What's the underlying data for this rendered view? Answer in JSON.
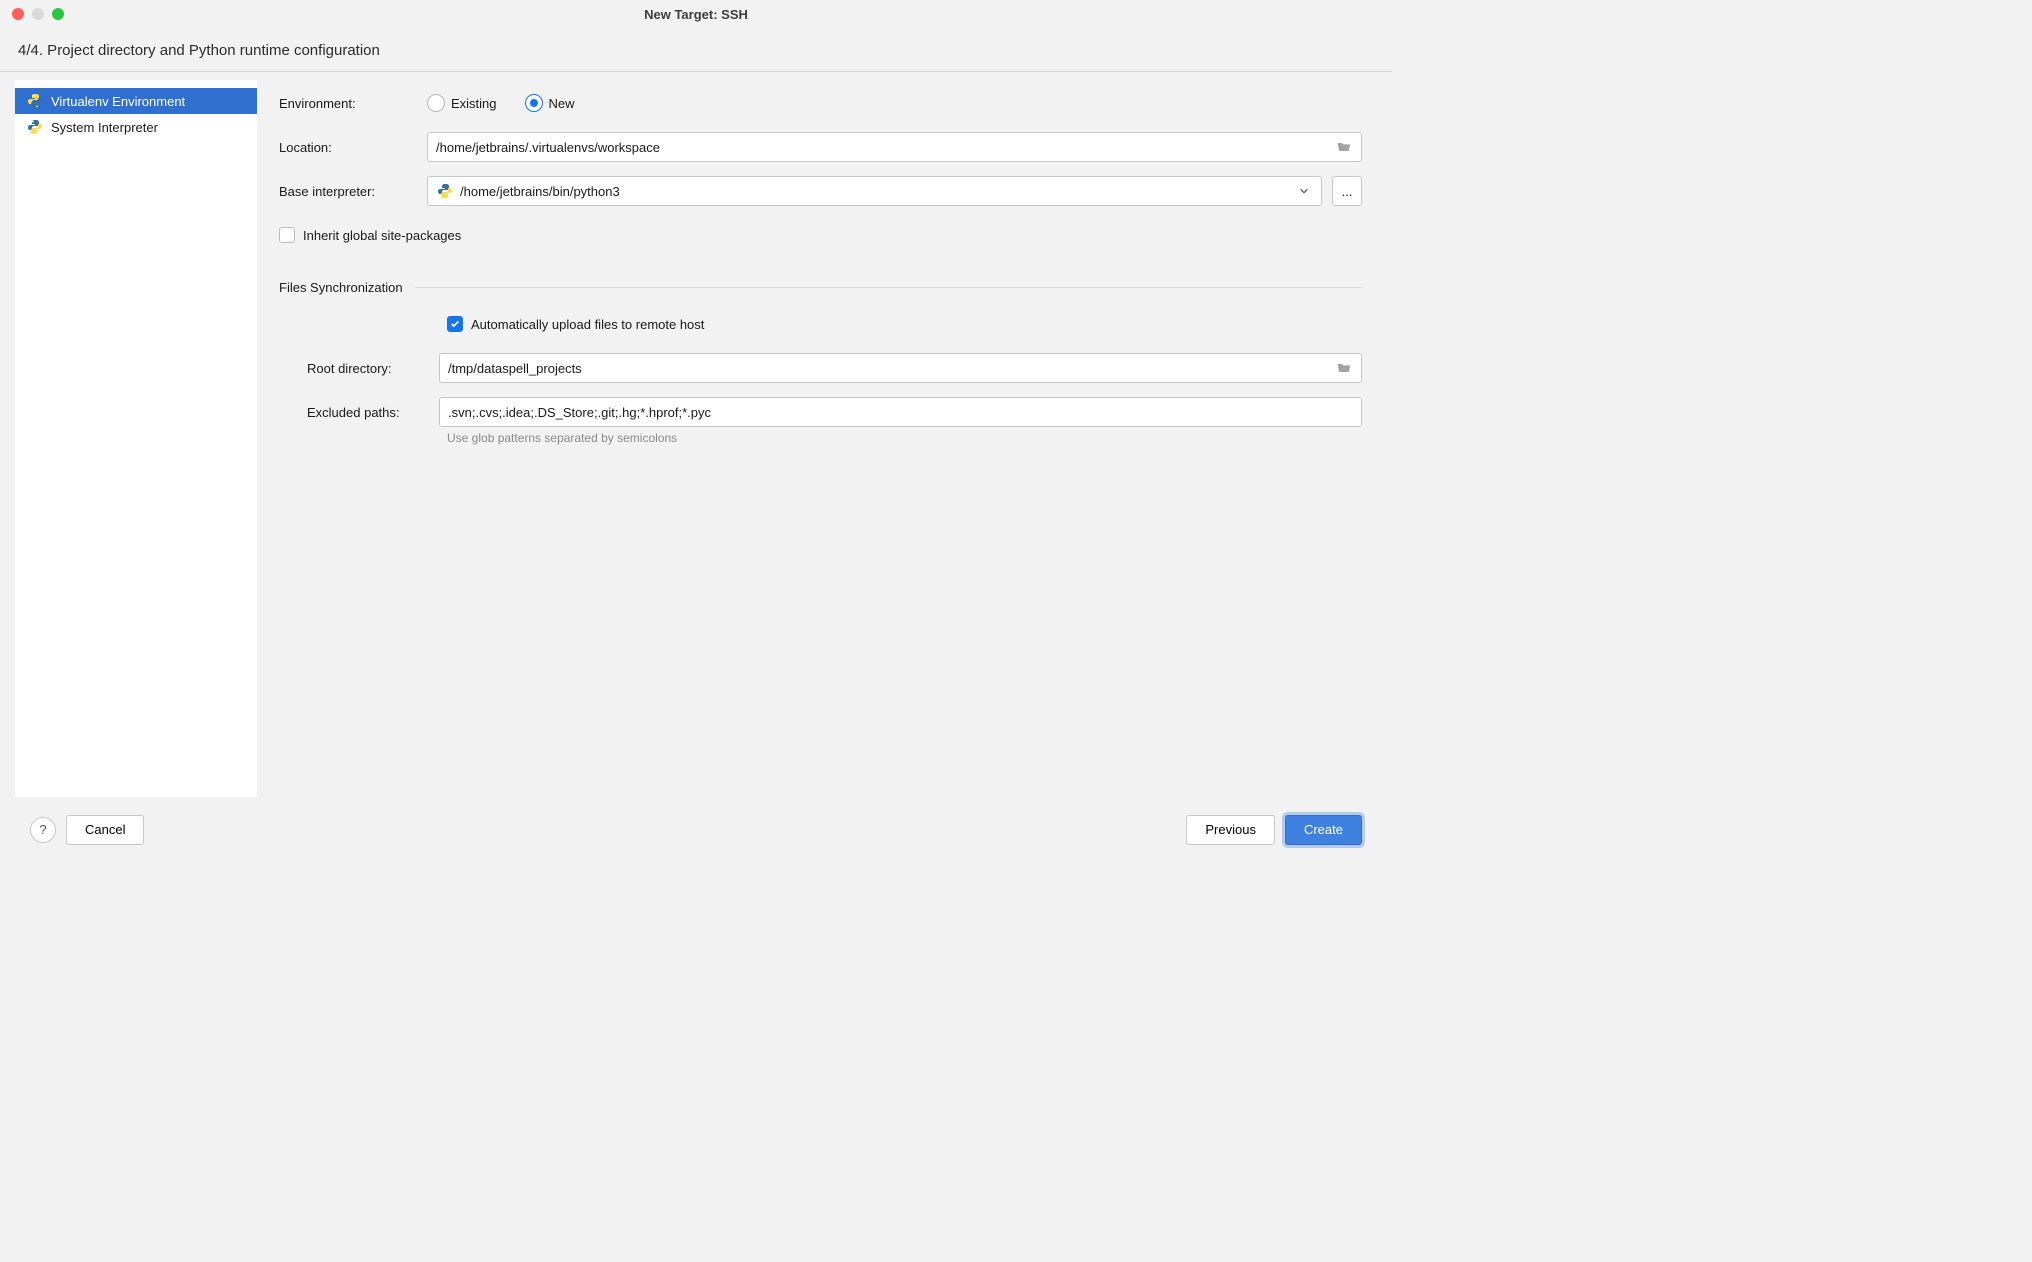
{
  "title": "New Target: SSH",
  "subtitle": "4/4. Project directory and Python runtime configuration",
  "sidebar": {
    "items": [
      {
        "label": "Virtualenv Environment",
        "selected": true,
        "icon": "python-icon"
      },
      {
        "label": "System Interpreter",
        "selected": false,
        "icon": "python-icon"
      }
    ]
  },
  "form": {
    "environment": {
      "label": "Environment:",
      "options": [
        "Existing",
        "New"
      ],
      "selected": "New"
    },
    "location": {
      "label": "Location:",
      "value": "/home/jetbrains/.virtualenvs/workspace"
    },
    "base_interpreter": {
      "label": "Base interpreter:",
      "value": "/home/jetbrains/bin/python3",
      "ellipsis": "..."
    },
    "inherit": {
      "label": "Inherit global site-packages",
      "checked": false
    },
    "sync": {
      "section_label": "Files Synchronization",
      "auto_upload": {
        "label": "Automatically upload files to remote host",
        "checked": true
      },
      "root_dir": {
        "label": "Root directory:",
        "value": "/tmp/dataspell_projects"
      },
      "excluded": {
        "label": "Excluded paths:",
        "value": ".svn;.cvs;.idea;.DS_Store;.git;.hg;*.hprof;*.pyc",
        "hint": "Use glob patterns separated by semicolons"
      }
    }
  },
  "footer": {
    "help": "?",
    "cancel": "Cancel",
    "previous": "Previous",
    "create": "Create"
  }
}
